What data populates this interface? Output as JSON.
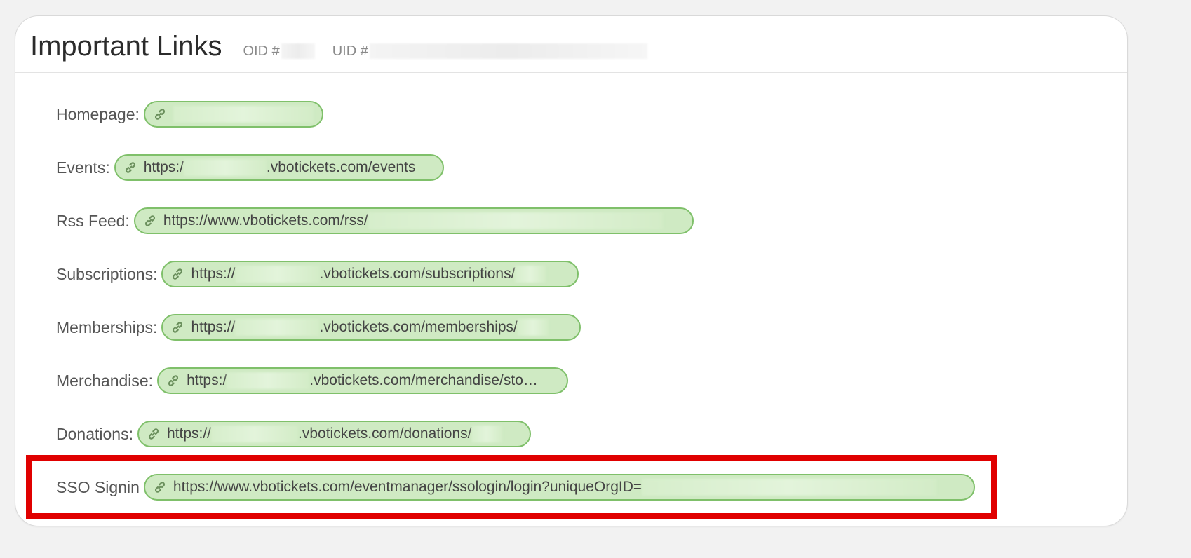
{
  "header": {
    "title": "Important Links",
    "oid_label": "OID #",
    "uid_label": "UID #"
  },
  "links": [
    {
      "label": "Homepage:",
      "url_prefix": "",
      "url_suffix": "",
      "icon": "link-icon"
    },
    {
      "label": "Events:",
      "url_prefix": "https:/",
      "url_suffix": ".vbotickets.com/events",
      "icon": "link-icon"
    },
    {
      "label": "Rss Feed:",
      "url_prefix": "https://www.vbotickets.com/rss/",
      "url_suffix": "",
      "icon": "link-icon"
    },
    {
      "label": "Subscriptions:",
      "url_prefix": "https://",
      "url_suffix": ".vbotickets.com/subscriptions/",
      "icon": "link-icon"
    },
    {
      "label": "Memberships:",
      "url_prefix": "https://",
      "url_suffix": ".vbotickets.com/memberships/",
      "icon": "link-icon"
    },
    {
      "label": "Merchandise:",
      "url_prefix": "https:/",
      "url_suffix": ".vbotickets.com/merchandise/sto…",
      "icon": "link-icon"
    },
    {
      "label": "Donations:",
      "url_prefix": "https://",
      "url_suffix": ".vbotickets.com/donations/",
      "icon": "link-icon"
    },
    {
      "label": "SSO Signin",
      "url_prefix": "https://www.vbotickets.com/eventmanager/ssologin/login?uniqueOrgID=",
      "url_suffix": "",
      "icon": "link-icon"
    }
  ],
  "colors": {
    "pill_fill": "#cfeac3",
    "pill_border": "#7fc06a",
    "highlight": "#e00000",
    "background": "#f2f2f2"
  }
}
